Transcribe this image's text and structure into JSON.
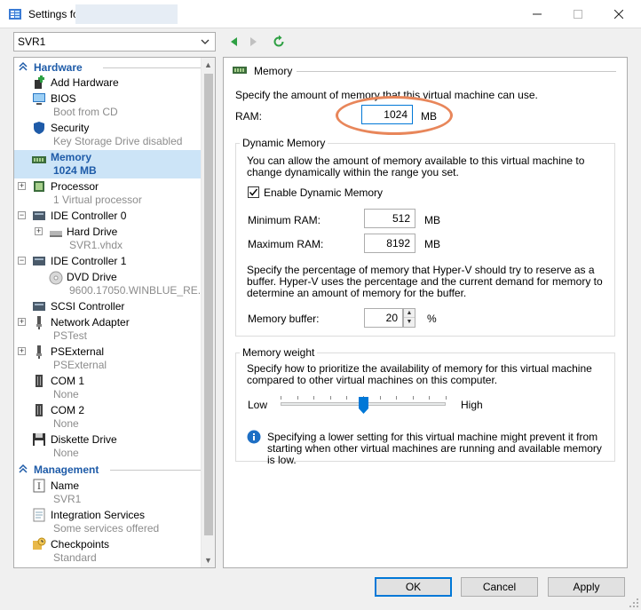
{
  "window": {
    "title": "Settings fo"
  },
  "toolbar": {
    "vm_selected": "SVR1"
  },
  "sidebar": {
    "hardware_header": "Hardware",
    "management_header": "Management",
    "items": {
      "add_hardware": "Add Hardware",
      "bios": "BIOS",
      "bios_sub": "Boot from CD",
      "security": "Security",
      "security_sub": "Key Storage Drive disabled",
      "memory": "Memory",
      "memory_sub": "1024 MB",
      "processor": "Processor",
      "processor_sub": "1 Virtual processor",
      "ide0": "IDE Controller 0",
      "hard_drive": "Hard Drive",
      "hard_drive_sub": "SVR1.vhdx",
      "ide1": "IDE Controller 1",
      "dvd": "DVD Drive",
      "dvd_sub": "9600.17050.WINBLUE_RE...",
      "scsi": "SCSI Controller",
      "net1": "Network Adapter",
      "net1_sub": "PSTest",
      "net2": "PSExternal",
      "net2_sub": "PSExternal",
      "com1": "COM 1",
      "com1_sub": "None",
      "com2": "COM 2",
      "com2_sub": "None",
      "diskette": "Diskette Drive",
      "diskette_sub": "None",
      "name": "Name",
      "name_sub": "SVR1",
      "integration": "Integration Services",
      "integration_sub": "Some services offered",
      "checkpoints": "Checkpoints",
      "checkpoints_sub": "Standard"
    }
  },
  "memory": {
    "heading": "Memory",
    "intro": "Specify the amount of memory that this virtual machine can use.",
    "ram_label": "RAM:",
    "ram_value": "1024",
    "ram_unit": "MB",
    "dynamic": {
      "title": "Dynamic Memory",
      "desc": "You can allow the amount of memory available to this virtual machine to change dynamically within the range you set.",
      "enable_label": "Enable Dynamic Memory",
      "enabled": true,
      "min_label": "Minimum RAM:",
      "min_value": "512",
      "min_unit": "MB",
      "max_label": "Maximum RAM:",
      "max_value": "8192",
      "max_unit": "MB",
      "buffer_desc": "Specify the percentage of memory that Hyper-V should try to reserve as a buffer. Hyper-V uses the percentage and the current demand for memory to determine an amount of memory for the buffer.",
      "buffer_label": "Memory buffer:",
      "buffer_value": "20",
      "buffer_unit": "%"
    },
    "weight": {
      "title": "Memory weight",
      "desc": "Specify how to prioritize the availability of memory for this virtual machine compared to other virtual machines on this computer.",
      "low_label": "Low",
      "high_label": "High",
      "slider_position": 0.5,
      "info": "Specifying a lower setting for this virtual machine might prevent it from starting when other virtual machines are running and available memory is low."
    }
  },
  "buttons": {
    "ok": "OK",
    "cancel": "Cancel",
    "apply": "Apply"
  },
  "colors": {
    "accent": "#1e5ba8",
    "selection": "#cce4f7",
    "highlight_oval": "#e8865a",
    "focus": "#0078d7"
  }
}
